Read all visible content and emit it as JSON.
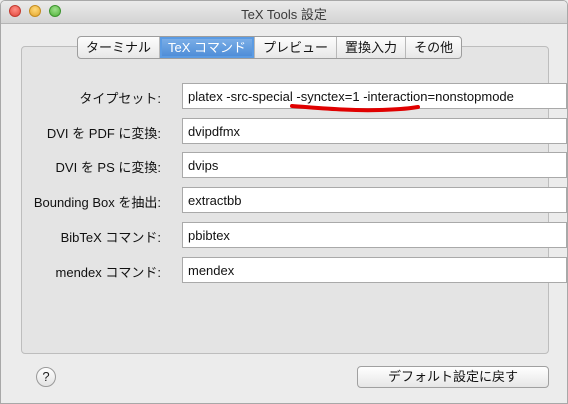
{
  "window": {
    "title": "TeX Tools 設定"
  },
  "tabs": [
    {
      "label": "ターミナル",
      "active": false
    },
    {
      "label": "TeX コマンド",
      "active": true
    },
    {
      "label": "プレビュー",
      "active": false
    },
    {
      "label": "置換入力",
      "active": false
    },
    {
      "label": "その他",
      "active": false
    }
  ],
  "fields": {
    "typeset": {
      "label": "タイプセット:",
      "value": "platex -src-special -synctex=1 -interaction=nonstopmode"
    },
    "dvipdf": {
      "label": "DVI を PDF に変換:",
      "value": "dvipdfmx"
    },
    "dvips": {
      "label": "DVI を PS に変換:",
      "value": "dvips"
    },
    "bbox": {
      "label": "Bounding Box を抽出:",
      "value": "extractbb"
    },
    "bibtex": {
      "label": "BibTeX コマンド:",
      "value": "pbibtex"
    },
    "mendex": {
      "label": "mendex コマンド:",
      "value": "mendex"
    }
  },
  "footer": {
    "help_label": "?",
    "defaults_label": "デフォルト設定に戻す"
  },
  "colors": {
    "annotation": "#e00000",
    "active_tab": "#4a8ad6"
  }
}
